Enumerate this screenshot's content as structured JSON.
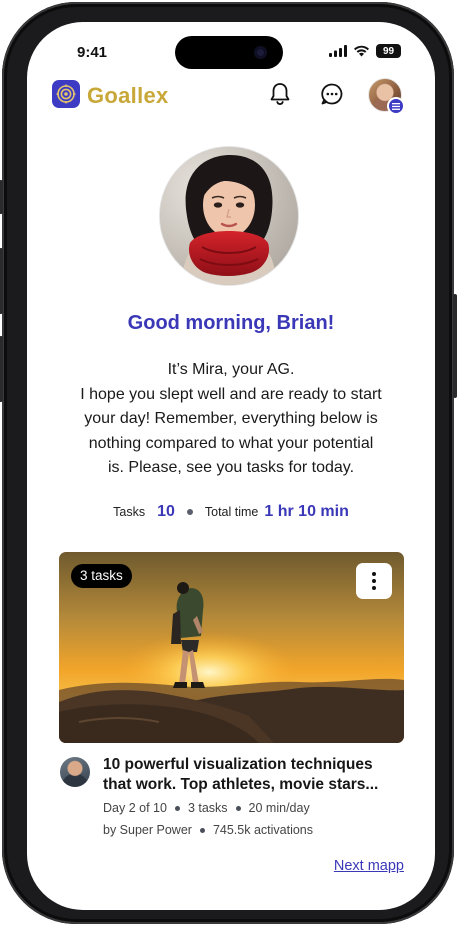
{
  "status_bar": {
    "time": "9:41",
    "battery": "99"
  },
  "header": {
    "app_name": "Goallex",
    "brand_color": "#3d3bc4",
    "logo_text_color": "#c9a83a"
  },
  "main": {
    "greeting": "Good morning, Brian!",
    "message_lines": [
      "It’s Mira, your AG.",
      "I hope you slept well and are ready to start",
      "your day! Remember, everything below is",
      "nothing compared to what your potential",
      "is. Please, see you tasks for today."
    ],
    "stats": {
      "tasks_label": "Tasks",
      "tasks_value": "10",
      "time_label": "Total time",
      "time_value": "1 hr 10 min"
    }
  },
  "card": {
    "badge": "3 tasks",
    "title_lines": [
      "10 powerful visualization techniques",
      "that work. Top athletes, movie stars..."
    ],
    "day": "Day 2 of 10",
    "tasks": "3 tasks",
    "duration": "20 min/day",
    "author": "by Super Power",
    "activations": "745.5k activations"
  },
  "footer": {
    "next_link": "Next mapp"
  }
}
